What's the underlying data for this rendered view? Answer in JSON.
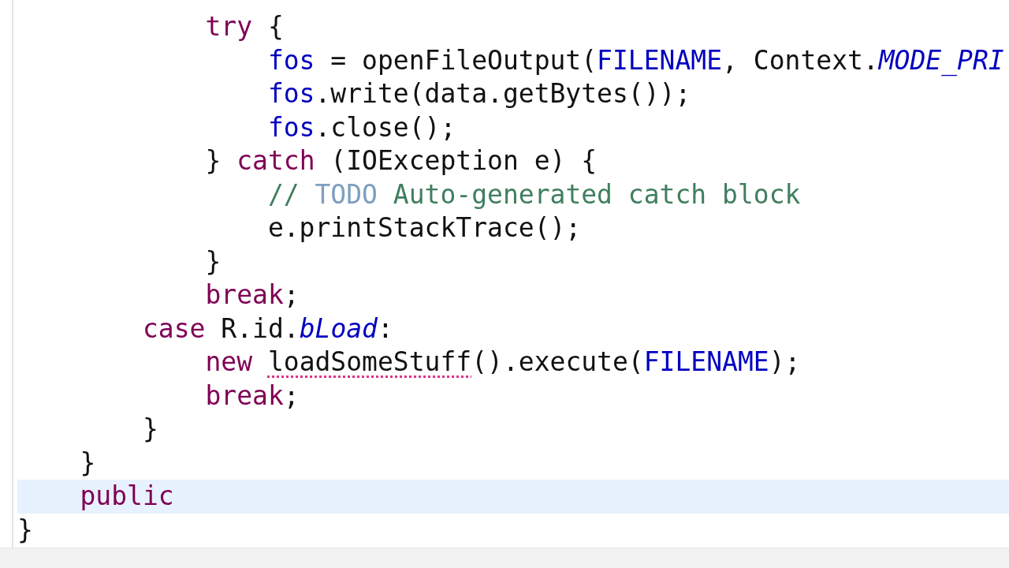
{
  "editor": {
    "lines": [
      {
        "children": [
          {
            "children": [
              {
                "children": [
                  {
                    "current": false,
                    "tokens": [
                      {
                        "kind": "keyword",
                        "text": "try"
                      },
                      {
                        "kind": "plain",
                        "text": " {"
                      }
                    ],
                    "children": [
                      {
                        "current": false,
                        "tokens": [
                          {
                            "kind": "field",
                            "text": "fos"
                          },
                          {
                            "kind": "plain",
                            "text": " = openFileOutput("
                          },
                          {
                            "kind": "field",
                            "text": "FILENAME"
                          },
                          {
                            "kind": "plain",
                            "text": ", Context."
                          },
                          {
                            "kind": "constant",
                            "text": "MODE_PRI"
                          }
                        ]
                      },
                      {
                        "current": false,
                        "tokens": [
                          {
                            "kind": "field",
                            "text": "fos"
                          },
                          {
                            "kind": "plain",
                            "text": ".write(data.getBytes());"
                          }
                        ]
                      },
                      {
                        "current": false,
                        "tokens": [
                          {
                            "kind": "field",
                            "text": "fos"
                          },
                          {
                            "kind": "plain",
                            "text": ".close();"
                          }
                        ]
                      }
                    ]
                  },
                  {
                    "current": false,
                    "tokens": [
                      {
                        "kind": "plain",
                        "text": "} "
                      },
                      {
                        "kind": "keyword",
                        "text": "catch"
                      },
                      {
                        "kind": "plain",
                        "text": " (IOException e) {"
                      }
                    ],
                    "children": [
                      {
                        "current": false,
                        "tokens": [
                          {
                            "kind": "comment",
                            "text": "// "
                          },
                          {
                            "kind": "todo",
                            "text": "TODO"
                          },
                          {
                            "kind": "comment",
                            "text": " Auto-generated catch block"
                          }
                        ]
                      },
                      {
                        "current": false,
                        "tokens": [
                          {
                            "kind": "plain",
                            "text": "e.printStackTrace();"
                          }
                        ]
                      }
                    ]
                  },
                  {
                    "current": false,
                    "tokens": [
                      {
                        "kind": "plain",
                        "text": "}"
                      }
                    ]
                  },
                  {
                    "current": false,
                    "tokens": [
                      {
                        "kind": "keyword",
                        "text": "break"
                      },
                      {
                        "kind": "plain",
                        "text": ";"
                      }
                    ]
                  }
                ]
              },
              {
                "current": false,
                "tokens": [
                  {
                    "kind": "keyword",
                    "text": "case"
                  },
                  {
                    "kind": "plain",
                    "text": " R.id."
                  },
                  {
                    "kind": "constant",
                    "text": "bLoad"
                  },
                  {
                    "kind": "plain",
                    "text": ":"
                  }
                ],
                "children": [
                  {
                    "current": false,
                    "tokens": [
                      {
                        "kind": "keyword",
                        "text": "new "
                      },
                      {
                        "kind": "error",
                        "text": "loadSomeStuff"
                      },
                      {
                        "kind": "plain",
                        "text": "().execute("
                      },
                      {
                        "kind": "field",
                        "text": "FILENAME"
                      },
                      {
                        "kind": "plain",
                        "text": ");"
                      }
                    ]
                  },
                  {
                    "current": false,
                    "tokens": [
                      {
                        "kind": "keyword",
                        "text": "break"
                      },
                      {
                        "kind": "plain",
                        "text": ";"
                      }
                    ]
                  }
                ]
              },
              {
                "current": false,
                "tokens": [
                  {
                    "kind": "plain",
                    "text": "}"
                  }
                ]
              }
            ]
          },
          {
            "current": false,
            "tokens": [
              {
                "kind": "plain",
                "text": "}"
              }
            ]
          },
          {
            "current": true,
            "tokens": [
              {
                "kind": "keyword",
                "text": "public"
              }
            ]
          }
        ]
      },
      {
        "current": false,
        "tokens": [
          {
            "kind": "plain",
            "text": "}"
          }
        ]
      }
    ]
  }
}
